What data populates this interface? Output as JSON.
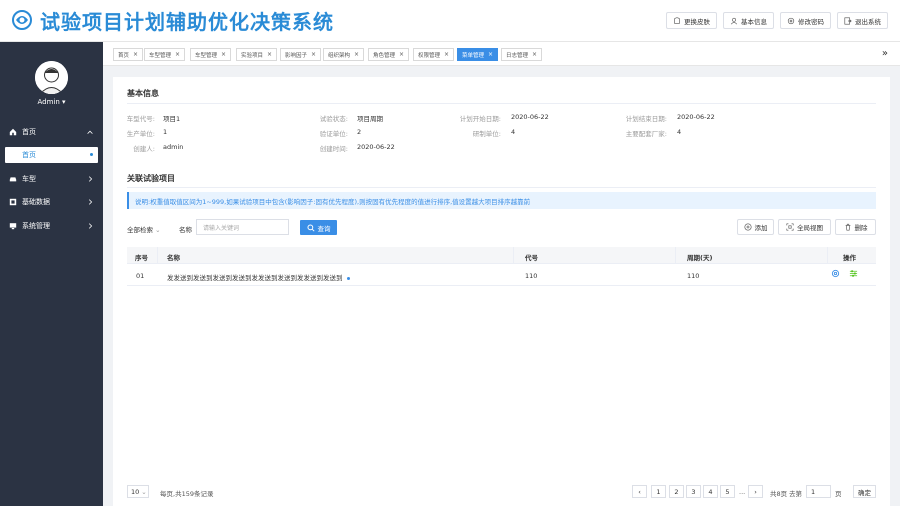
{
  "header": {
    "title": "试验项目计划辅助优化决策系统",
    "buttons": [
      {
        "label": "更换皮肤",
        "icon": "skin-icon"
      },
      {
        "label": "基本信息",
        "icon": "user-icon"
      },
      {
        "label": "修改密码",
        "icon": "settings-icon"
      },
      {
        "label": "退出系统",
        "icon": "logout-icon"
      }
    ]
  },
  "sidebar": {
    "user": "Admin",
    "menu": [
      {
        "label": "首页",
        "icon": "home-icon",
        "expanded": true
      },
      {
        "label": "车型",
        "icon": "car-icon"
      },
      {
        "label": "基础数据",
        "icon": "database-icon"
      },
      {
        "label": "系统管理",
        "icon": "monitor-icon"
      }
    ],
    "active_sub": "首页"
  },
  "tabs": [
    {
      "label": "首页"
    },
    {
      "label": "车型管理"
    },
    {
      "label": "车型管理"
    },
    {
      "label": "实验项目"
    },
    {
      "label": "影响因子"
    },
    {
      "label": "组织架构"
    },
    {
      "label": "角色管理"
    },
    {
      "label": "权限管理"
    },
    {
      "label": "菜单管理",
      "active": true
    },
    {
      "label": "日志管理"
    }
  ],
  "basic": {
    "title": "基本信息",
    "fields": {
      "model_code": {
        "label": "车型代号:",
        "value": "项目1"
      },
      "test_status": {
        "label": "试验状态:",
        "value": "项目周期"
      },
      "plan_start": {
        "label": "计划开始日期:",
        "value": "2020-06-22"
      },
      "plan_end": {
        "label": "计划结束日期:",
        "value": "2020-06-22"
      },
      "prod_unit": {
        "label": "生产单位:",
        "value": "1"
      },
      "verify_unit": {
        "label": "验证单位:",
        "value": "2"
      },
      "rd_unit": {
        "label": "研制单位:",
        "value": "4"
      },
      "supplier": {
        "label": "主要配套厂家:",
        "value": "4"
      },
      "creator": {
        "label": "创建人:",
        "value": "admin"
      },
      "created": {
        "label": "创建时间:",
        "value": "2020-06-22"
      }
    }
  },
  "related": {
    "title": "关联试验项目",
    "notice": "说明:权重值取值区间为1~999,如果试验项目中包含(影响因子:固有优先程度),则按固有优先程度的值进行排序,值设置越大项目排序越靠前",
    "filter_all": "全部检索",
    "name_label": "名称",
    "search_placeholder": "请输入关键词",
    "query_label": "查询",
    "actions": {
      "add": "添加",
      "fullview": "全局视图",
      "delete": "删除"
    },
    "columns": [
      "序号",
      "名称",
      "代号",
      "周期(天)",
      "操作"
    ],
    "rows": [
      {
        "index": "01",
        "name": "发发送到发送到发送到发送到发发送到发送到发发送到发送到",
        "code": "110",
        "period": "110"
      }
    ]
  },
  "pagination": {
    "page_size": "10",
    "info": "每页,共159条记录",
    "pages": [
      "1",
      "2",
      "3",
      "4",
      "5"
    ],
    "ellipsis": "...",
    "total_pages": "共8页",
    "goto_label": "去第",
    "goto_value": "1",
    "page_unit": "页",
    "confirm": "确定"
  },
  "colors": {
    "accent": "#3a8ee6",
    "sidebar": "#2b3343",
    "title": "#2a8bd6"
  }
}
